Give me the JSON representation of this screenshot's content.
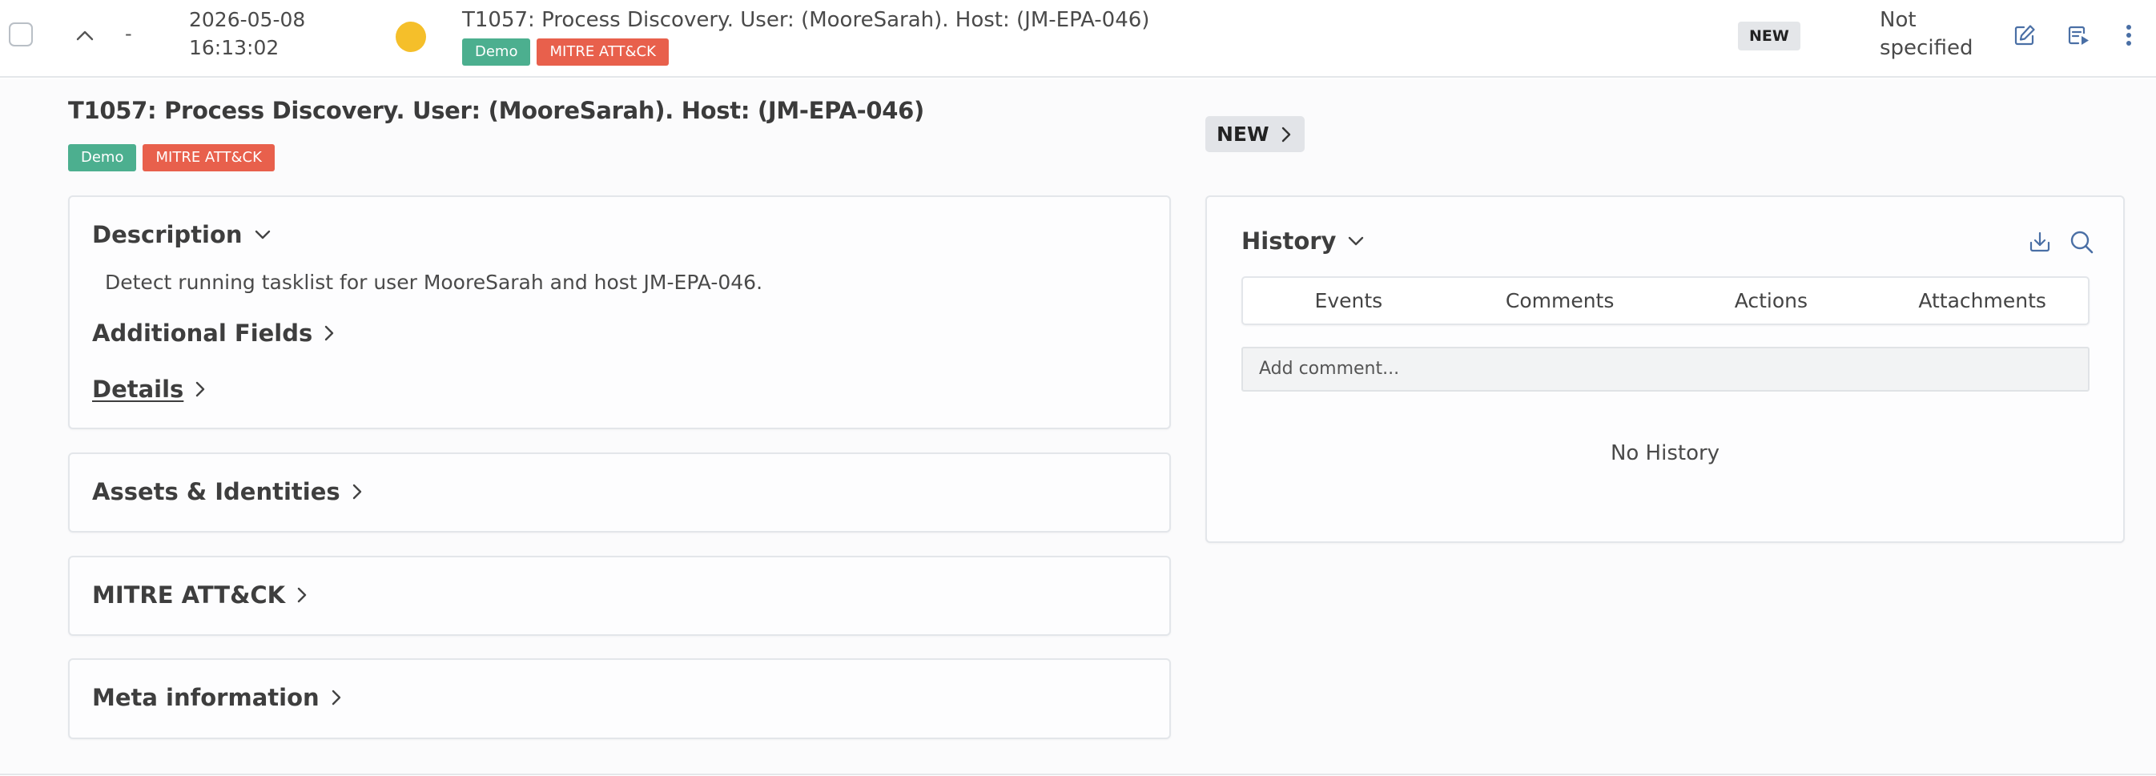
{
  "row": {
    "dash": "-",
    "date": "2026-05-08",
    "time": "16:13:02",
    "title": "T1057: Process Discovery. User: (MooreSarah). Host: (JM-EPA-046)",
    "tags": [
      "Demo",
      "MITRE ATT&CK"
    ],
    "status": "NEW",
    "assignee_line1": "Not",
    "assignee_line2": "specified",
    "icons": [
      "edit-icon",
      "run-playbook-icon",
      "more-vertical-icon"
    ]
  },
  "detail": {
    "title": "T1057: Process Discovery. User: (MooreSarah). Host: (JM-EPA-046)",
    "tags": [
      "Demo",
      "MITRE ATT&CK"
    ],
    "status_button": "NEW",
    "description": {
      "heading": "Description",
      "text": "Detect running tasklist for user MooreSarah and host JM-EPA-046.",
      "additional_fields": "Additional Fields",
      "details": "Details"
    },
    "sections": {
      "assets": "Assets & Identities",
      "mitre": "MITRE ATT&CK",
      "meta": "Meta information"
    },
    "history": {
      "heading": "History",
      "tabs": [
        "Events",
        "Comments",
        "Actions",
        "Attachments"
      ],
      "comment_placeholder": "Add comment...",
      "empty": "No History"
    }
  },
  "colors": {
    "tag_demo": "#4caf8f",
    "tag_mitre": "#e8604c",
    "severity_dot": "#f5bf2a",
    "status_badge": "#e4e6e9"
  }
}
